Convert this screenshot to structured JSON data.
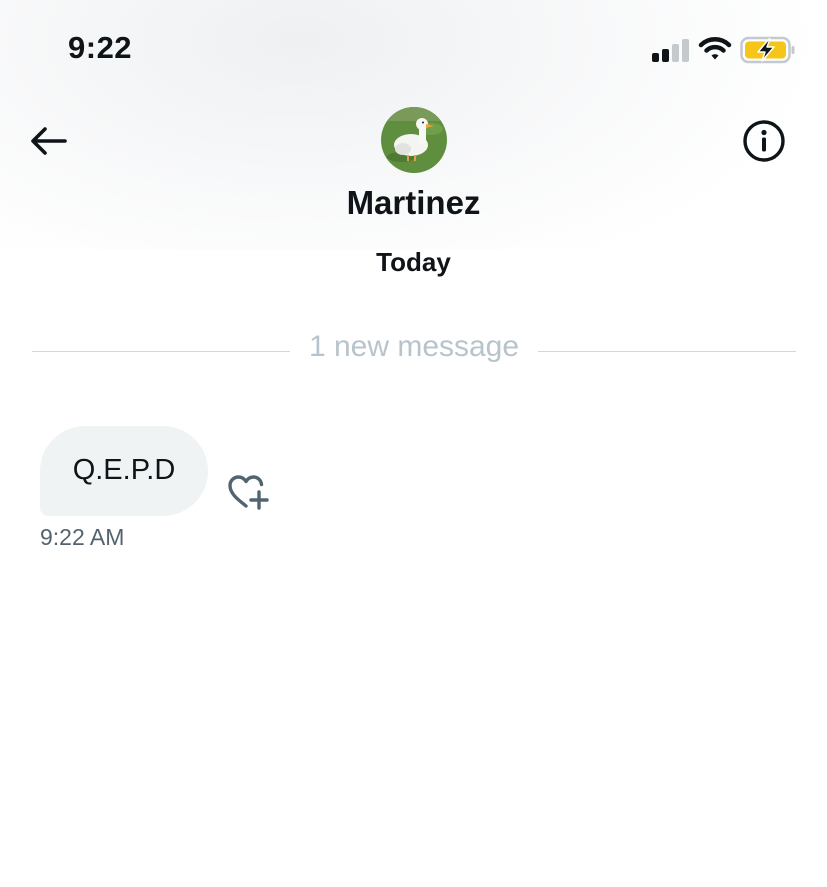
{
  "status_bar": {
    "time": "9:22",
    "signal_icon": "cellular-signal-icon",
    "wifi_icon": "wifi-icon",
    "battery_icon": "battery-charging-icon",
    "battery_color": "#f5c518"
  },
  "header": {
    "back_icon": "arrow-left-icon",
    "info_icon": "info-circle-icon",
    "avatar_alt": "duck",
    "contact_name": "Martinez",
    "date_label": "Today"
  },
  "divider": {
    "text": "1 new message"
  },
  "messages": [
    {
      "text": "Q.E.P.D",
      "time": "9:22 AM",
      "reaction_icon": "heart-plus-icon"
    }
  ],
  "colors": {
    "text_primary": "#0f1419",
    "text_secondary": "#536471",
    "bubble_bg": "#eff3f4",
    "divider": "#cfd9de",
    "divider_text": "#b8c4cc"
  }
}
